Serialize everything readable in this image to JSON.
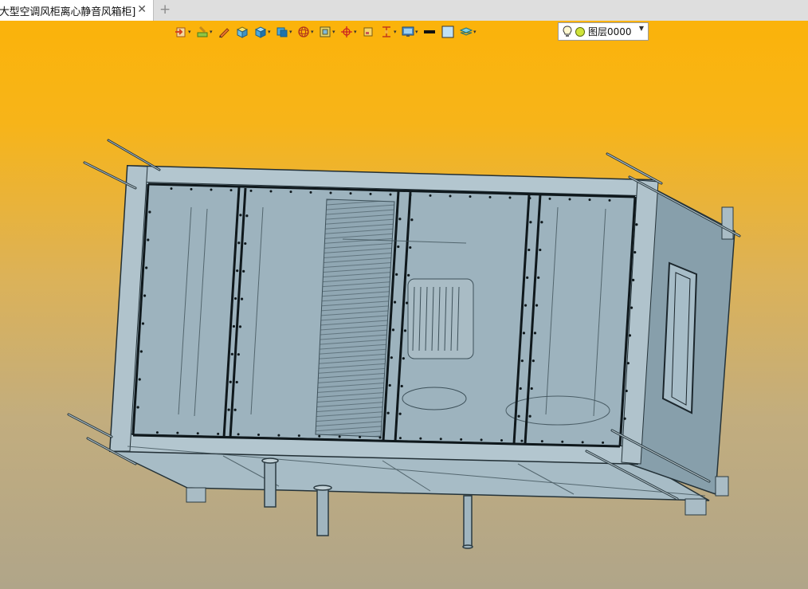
{
  "tab": {
    "title": "[大型空调风柜离心静音风箱柜]",
    "close_glyph": "✕",
    "new_tab_glyph": "+"
  },
  "toolbar": {
    "icons": [
      "import-icon",
      "paint-icon",
      "pencil-icon",
      "box-material-icon",
      "cube-icon",
      "cube-view-icon",
      "sphere-icon",
      "frame-icon",
      "target-icon",
      "small-square-icon",
      "dimension-icon",
      "monitor-icon",
      "line-style-icon",
      "fill-color-icon",
      "layers-icon"
    ]
  },
  "layer": {
    "name": "图层0000",
    "dropdown_glyph": "▼"
  },
  "colors": {
    "background_top": "#fbb30a",
    "background_bottom": "#b0a589",
    "model_fill": "#96aebb",
    "model_edge": "#1e2a30"
  }
}
